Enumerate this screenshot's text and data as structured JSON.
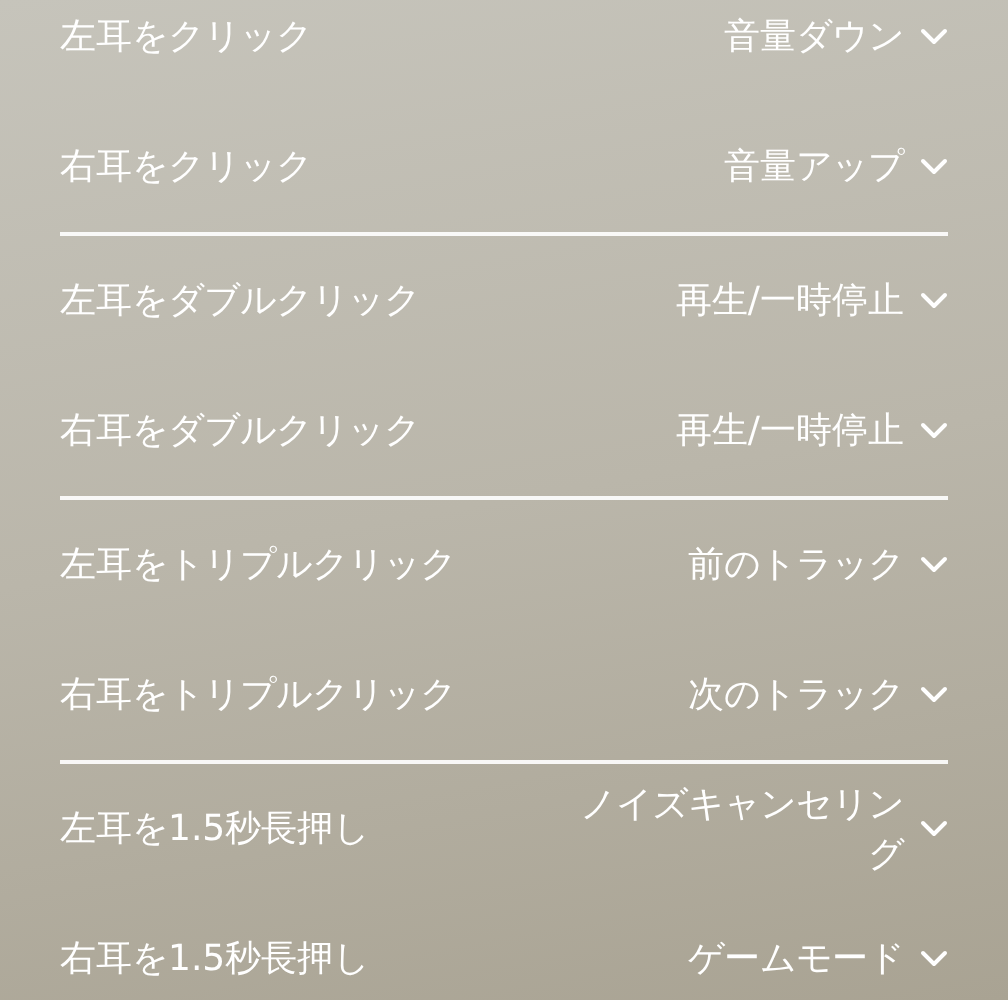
{
  "groups": [
    {
      "rows": [
        {
          "label": "左耳をクリック",
          "value": "音量ダウン"
        },
        {
          "label": "右耳をクリック",
          "value": "音量アップ"
        }
      ]
    },
    {
      "rows": [
        {
          "label": "左耳をダブルクリック",
          "value": "再生/一時停止"
        },
        {
          "label": "右耳をダブルクリック",
          "value": "再生/一時停止"
        }
      ]
    },
    {
      "rows": [
        {
          "label": "左耳をトリプルクリック",
          "value": "前のトラック"
        },
        {
          "label": "右耳をトリプルクリック",
          "value": "次のトラック"
        }
      ]
    },
    {
      "rows": [
        {
          "label": "左耳を1.5秒長押し",
          "value": "ノイズキャンセリング"
        },
        {
          "label": "右耳を1.5秒長押し",
          "value": "ゲームモード"
        }
      ]
    }
  ]
}
